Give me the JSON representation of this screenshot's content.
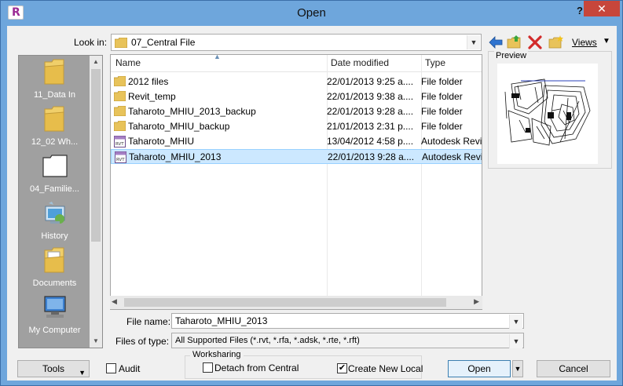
{
  "window": {
    "title": "Open",
    "help": "?",
    "close": "✕"
  },
  "toolbar": {
    "look_in_label": "Look in:",
    "look_in_value": "07_Central File",
    "views_label": "Views"
  },
  "places": [
    {
      "label": "11_Data In",
      "icon": "folder-icon"
    },
    {
      "label": "12_02 Wh...",
      "icon": "folder-icon"
    },
    {
      "label": "04_Familie...",
      "icon": "blank-folder-icon"
    },
    {
      "label": "History",
      "icon": "history-icon"
    },
    {
      "label": "Documents",
      "icon": "documents-icon"
    },
    {
      "label": "My Computer",
      "icon": "computer-icon"
    }
  ],
  "columns": {
    "name": "Name",
    "date": "Date modified",
    "type": "Type"
  },
  "files": [
    {
      "name": "2012 files",
      "date": "22/01/2013 9:25 a....",
      "type": "File folder",
      "kind": "folder"
    },
    {
      "name": "Revit_temp",
      "date": "22/01/2013 9:38 a....",
      "type": "File folder",
      "kind": "folder"
    },
    {
      "name": "Taharoto_MHIU_2013_backup",
      "date": "22/01/2013 9:28 a....",
      "type": "File folder",
      "kind": "folder"
    },
    {
      "name": "Taharoto_MHIU_backup",
      "date": "21/01/2013 2:31 p....",
      "type": "File folder",
      "kind": "folder"
    },
    {
      "name": "Taharoto_MHIU",
      "date": "13/04/2012 4:58 p....",
      "type": "Autodesk Revi",
      "kind": "rvt"
    },
    {
      "name": "Taharoto_MHIU_2013",
      "date": "22/01/2013 9:28 a....",
      "type": "Autodesk Revi",
      "kind": "rvt",
      "selected": true
    }
  ],
  "preview": {
    "label": "Preview"
  },
  "form": {
    "file_name_label": "File name:",
    "file_name_value": "Taharoto_MHIU_2013",
    "file_type_label": "Files of type:",
    "file_type_value": "All Supported Files  (*.rvt, *.rfa, *.adsk, *.rte, *.rft)"
  },
  "bottom": {
    "tools": "Tools",
    "audit": "Audit",
    "audit_checked": false,
    "worksharing": "Worksharing",
    "detach": "Detach from Central",
    "detach_checked": false,
    "create_local": "Create New Local",
    "create_local_checked": true,
    "open": "Open",
    "cancel": "Cancel"
  },
  "colors": {
    "title_bar": "#6ea6dc",
    "close": "#c7463b",
    "selection": "#cce8ff",
    "folder": "#e8c35a"
  }
}
